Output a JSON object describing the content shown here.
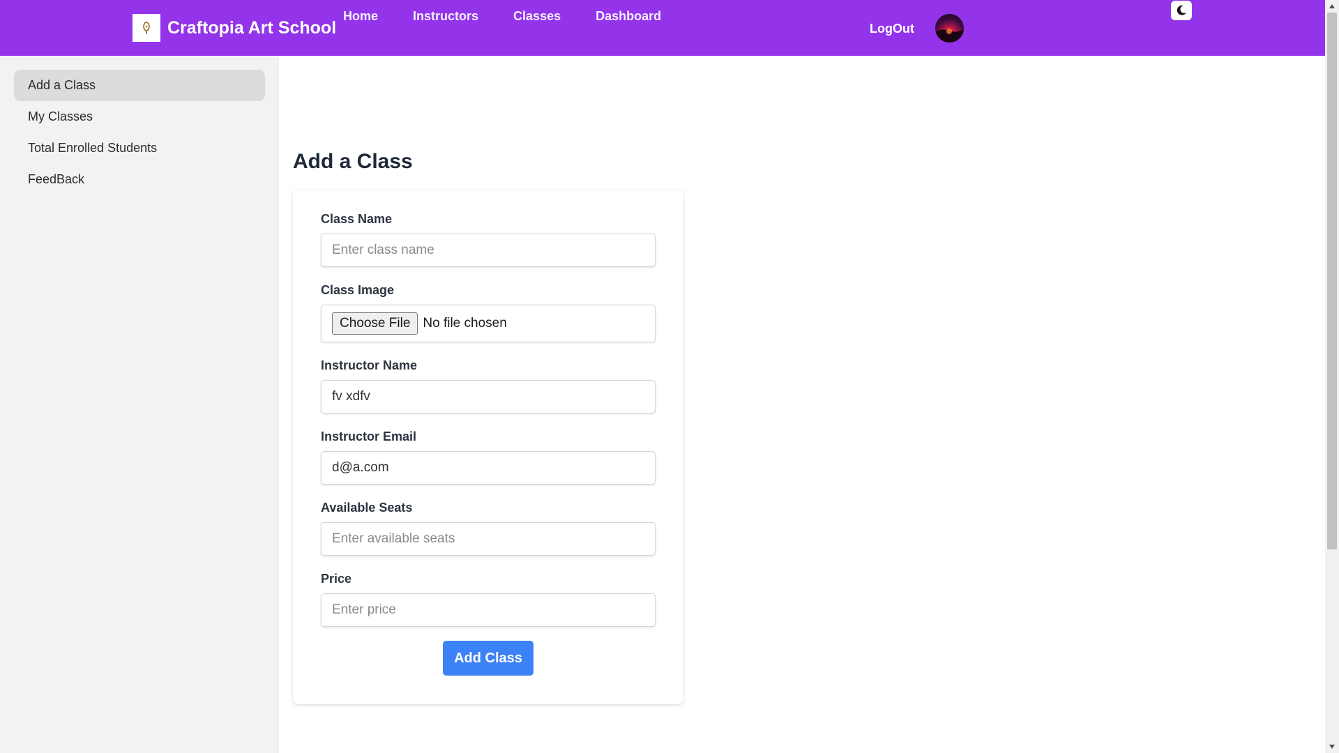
{
  "header": {
    "brand_name": "Craftopia Art School",
    "nav": [
      "Home",
      "Instructors",
      "Classes",
      "Dashboard"
    ],
    "logout_label": "LogOut",
    "avatar_icon": "user-avatar",
    "theme_icon": "moon-icon",
    "logo_icon": "brush-icon"
  },
  "sidebar": {
    "items": [
      {
        "label": "Add a Class",
        "active": true
      },
      {
        "label": "My Classes"
      },
      {
        "label": "Total Enrolled Students"
      },
      {
        "label": "FeedBack"
      }
    ]
  },
  "main": {
    "title": "Add a Class",
    "form": {
      "class_name": {
        "label": "Class Name",
        "placeholder": "Enter class name",
        "value": ""
      },
      "class_image": {
        "label": "Class Image",
        "button_label": "Choose File",
        "status": "No file chosen"
      },
      "instructor_name": {
        "label": "Instructor Name",
        "value": "fv xdfv"
      },
      "instructor_email": {
        "label": "Instructor Email",
        "value": "d@a.com"
      },
      "available_seats": {
        "label": "Available Seats",
        "placeholder": "Enter available seats",
        "value": ""
      },
      "price": {
        "label": "Price",
        "placeholder": "Enter price",
        "value": ""
      },
      "submit_label": "Add Class"
    }
  },
  "colors": {
    "navbar": "#9333ea",
    "sidebar": "#f2f2f2",
    "sidebar_active": "#dcdcdc",
    "primary_button": "#3b82f6"
  }
}
